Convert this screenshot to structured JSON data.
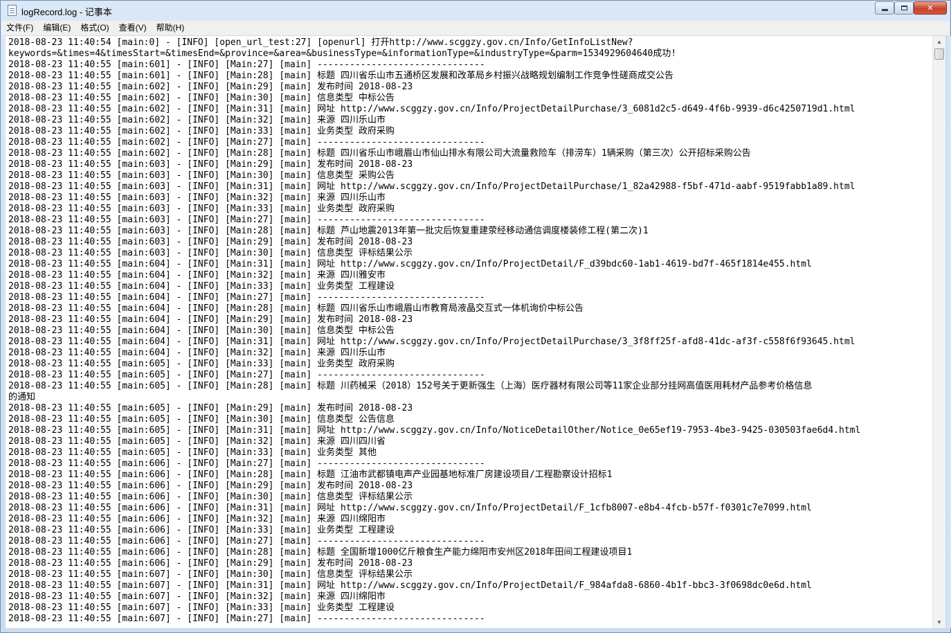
{
  "window": {
    "title": "logRecord.log - 记事本",
    "controls": {
      "minimize": "",
      "maximize": "",
      "close": "✕"
    }
  },
  "menu": [
    "文件(F)",
    "编辑(E)",
    "格式(O)",
    "查看(V)",
    "帮助(H)"
  ],
  "log_lines": [
    "2018-08-23 11:40:54 [main:0] - [INFO] [open_url_test:27] [openurl] 打开http://www.scggzy.gov.cn/Info/GetInfoListNew?",
    "keywords=&times=4&timesStart=&timesEnd=&province=&area=&businessType=&informationType=&industryType=&parm=1534929604640成功!",
    "2018-08-23 11:40:55 [main:601] - [INFO] [Main:27] [main] -------------------------------",
    "2018-08-23 11:40:55 [main:601] - [INFO] [Main:28] [main] 标题 四川省乐山市五通桥区发展和改革局乡村振兴战略规划编制工作竞争性磋商成交公告",
    "2018-08-23 11:40:55 [main:602] - [INFO] [Main:29] [main] 发布时间 2018-08-23",
    "2018-08-23 11:40:55 [main:602] - [INFO] [Main:30] [main] 信息类型 中标公告",
    "2018-08-23 11:40:55 [main:602] - [INFO] [Main:31] [main] 网址 http://www.scggzy.gov.cn/Info/ProjectDetailPurchase/3_6081d2c5-d649-4f6b-9939-d6c4250719d1.html",
    "2018-08-23 11:40:55 [main:602] - [INFO] [Main:32] [main] 来源 四川乐山市",
    "2018-08-23 11:40:55 [main:602] - [INFO] [Main:33] [main] 业务类型 政府采购",
    "2018-08-23 11:40:55 [main:602] - [INFO] [Main:27] [main] -------------------------------",
    "2018-08-23 11:40:55 [main:602] - [INFO] [Main:28] [main] 标题 四川省乐山市峨眉山市仙山排水有限公司大流量救险车（排涝车）1辆采购（第三次）公开招标采购公告",
    "2018-08-23 11:40:55 [main:603] - [INFO] [Main:29] [main] 发布时间 2018-08-23",
    "2018-08-23 11:40:55 [main:603] - [INFO] [Main:30] [main] 信息类型 采购公告",
    "2018-08-23 11:40:55 [main:603] - [INFO] [Main:31] [main] 网址 http://www.scggzy.gov.cn/Info/ProjectDetailPurchase/1_82a42988-f5bf-471d-aabf-9519fabb1a89.html",
    "2018-08-23 11:40:55 [main:603] - [INFO] [Main:32] [main] 来源 四川乐山市",
    "2018-08-23 11:40:55 [main:603] - [INFO] [Main:33] [main] 业务类型 政府采购",
    "2018-08-23 11:40:55 [main:603] - [INFO] [Main:27] [main] -------------------------------",
    "2018-08-23 11:40:55 [main:603] - [INFO] [Main:28] [main] 标题 芦山地震2013年第一批灾后恢复重建荥经移动通信调度楼装修工程(第二次)1",
    "2018-08-23 11:40:55 [main:603] - [INFO] [Main:29] [main] 发布时间 2018-08-23",
    "2018-08-23 11:40:55 [main:603] - [INFO] [Main:30] [main] 信息类型 评标结果公示",
    "2018-08-23 11:40:55 [main:604] - [INFO] [Main:31] [main] 网址 http://www.scggzy.gov.cn/Info/ProjectDetail/F_d39bdc60-1ab1-4619-bd7f-465f1814e455.html",
    "2018-08-23 11:40:55 [main:604] - [INFO] [Main:32] [main] 来源 四川雅安市",
    "2018-08-23 11:40:55 [main:604] - [INFO] [Main:33] [main] 业务类型 工程建设",
    "2018-08-23 11:40:55 [main:604] - [INFO] [Main:27] [main] -------------------------------",
    "2018-08-23 11:40:55 [main:604] - [INFO] [Main:28] [main] 标题 四川省乐山市峨眉山市教育局液晶交互式一体机询价中标公告",
    "2018-08-23 11:40:55 [main:604] - [INFO] [Main:29] [main] 发布时间 2018-08-23",
    "2018-08-23 11:40:55 [main:604] - [INFO] [Main:30] [main] 信息类型 中标公告",
    "2018-08-23 11:40:55 [main:604] - [INFO] [Main:31] [main] 网址 http://www.scggzy.gov.cn/Info/ProjectDetailPurchase/3_3f8ff25f-afd8-41dc-af3f-c558f6f93645.html",
    "2018-08-23 11:40:55 [main:604] - [INFO] [Main:32] [main] 来源 四川乐山市",
    "2018-08-23 11:40:55 [main:605] - [INFO] [Main:33] [main] 业务类型 政府采购",
    "2018-08-23 11:40:55 [main:605] - [INFO] [Main:27] [main] -------------------------------",
    "2018-08-23 11:40:55 [main:605] - [INFO] [Main:28] [main] 标题 川药械采（2018）152号关于更新强生（上海）医疗器材有限公司等11家企业部分挂网高值医用耗材产品参考价格信息",
    "的通知",
    "2018-08-23 11:40:55 [main:605] - [INFO] [Main:29] [main] 发布时间 2018-08-23",
    "2018-08-23 11:40:55 [main:605] - [INFO] [Main:30] [main] 信息类型 公告信息",
    "2018-08-23 11:40:55 [main:605] - [INFO] [Main:31] [main] 网址 http://www.scggzy.gov.cn/Info/NoticeDetailOther/Notice_0e65ef19-7953-4be3-9425-030503fae6d4.html",
    "2018-08-23 11:40:55 [main:605] - [INFO] [Main:32] [main] 来源 四川四川省",
    "2018-08-23 11:40:55 [main:605] - [INFO] [Main:33] [main] 业务类型 其他",
    "2018-08-23 11:40:55 [main:606] - [INFO] [Main:27] [main] -------------------------------",
    "2018-08-23 11:40:55 [main:606] - [INFO] [Main:28] [main] 标题 江油市武都镇电声产业园基地标准厂房建设项目/工程勘察设计招标1",
    "2018-08-23 11:40:55 [main:606] - [INFO] [Main:29] [main] 发布时间 2018-08-23",
    "2018-08-23 11:40:55 [main:606] - [INFO] [Main:30] [main] 信息类型 评标结果公示",
    "2018-08-23 11:40:55 [main:606] - [INFO] [Main:31] [main] 网址 http://www.scggzy.gov.cn/Info/ProjectDetail/F_1cfb8007-e8b4-4fcb-b57f-f0301c7e7099.html",
    "2018-08-23 11:40:55 [main:606] - [INFO] [Main:32] [main] 来源 四川绵阳市",
    "2018-08-23 11:40:55 [main:606] - [INFO] [Main:33] [main] 业务类型 工程建设",
    "2018-08-23 11:40:55 [main:606] - [INFO] [Main:27] [main] -------------------------------",
    "2018-08-23 11:40:55 [main:606] - [INFO] [Main:28] [main] 标题 全国新增1000亿斤粮食生产能力绵阳市安州区2018年田间工程建设项目1",
    "2018-08-23 11:40:55 [main:606] - [INFO] [Main:29] [main] 发布时间 2018-08-23",
    "2018-08-23 11:40:55 [main:607] - [INFO] [Main:30] [main] 信息类型 评标结果公示",
    "2018-08-23 11:40:55 [main:607] - [INFO] [Main:31] [main] 网址 http://www.scggzy.gov.cn/Info/ProjectDetail/F_984afda8-6860-4b1f-bbc3-3f0698dc0e6d.html",
    "2018-08-23 11:40:55 [main:607] - [INFO] [Main:32] [main] 来源 四川绵阳市",
    "2018-08-23 11:40:55 [main:607] - [INFO] [Main:33] [main] 业务类型 工程建设",
    "2018-08-23 11:40:55 [main:607] - [INFO] [Main:27] [main] -------------------------------"
  ],
  "scrollbar": {
    "up_arrow": "▲",
    "down_arrow": "▼",
    "position": 0.0
  }
}
